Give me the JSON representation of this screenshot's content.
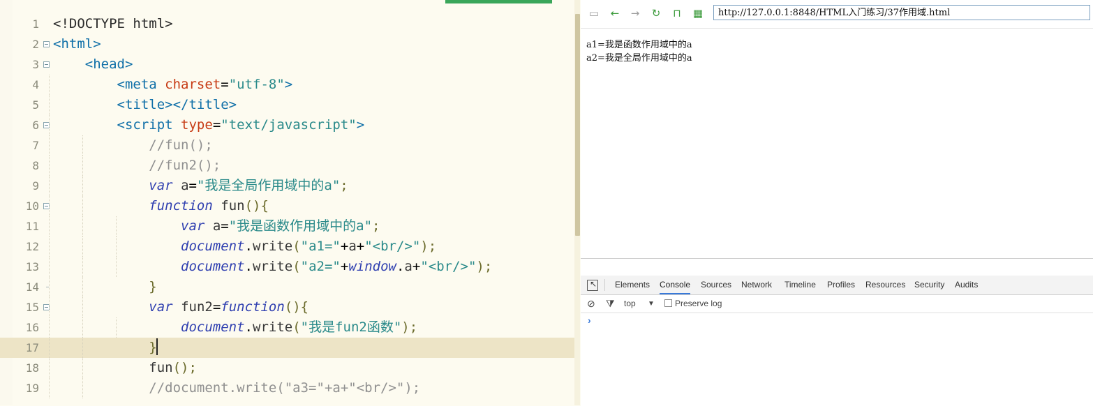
{
  "editor": {
    "lines": [
      {
        "num": "1",
        "html": "<span class=\"t-plain\">&lt;!DOCTYPE html&gt;</span>"
      },
      {
        "num": "2",
        "html": "<span class=\"t-tag\">&lt;html&gt;</span>"
      },
      {
        "num": "3",
        "html": "    <span class=\"t-tag\">&lt;head&gt;</span>"
      },
      {
        "num": "4",
        "html": "        <span class=\"t-tag\">&lt;meta</span> <span class=\"t-attr\">charset</span>=<span class=\"t-str\">\"utf-8\"</span><span class=\"t-tag\">&gt;</span>"
      },
      {
        "num": "5",
        "html": "        <span class=\"t-tag\">&lt;title&gt;&lt;/title&gt;</span>"
      },
      {
        "num": "6",
        "html": "        <span class=\"t-tag\">&lt;script</span> <span class=\"t-attr\">type</span>=<span class=\"t-str\">\"text/javascript\"</span><span class=\"t-tag\">&gt;</span>"
      },
      {
        "num": "7",
        "html": "            <span class=\"t-com\">//fun();</span>"
      },
      {
        "num": "8",
        "html": "            <span class=\"t-com\">//fun2();</span>"
      },
      {
        "num": "9",
        "html": "            <span class=\"t-kw\">var</span> <span class=\"t-fn\">a</span>=<span class=\"t-str\">\"我是全局作用域中的a\"</span><span class=\"t-punc\">;</span>"
      },
      {
        "num": "10",
        "html": "            <span class=\"t-kw\">function</span> <span class=\"t-fn\">fun</span><span class=\"t-punc\">(){</span>"
      },
      {
        "num": "11",
        "html": "                <span class=\"t-kw\">var</span> <span class=\"t-fn\">a</span>=<span class=\"t-str\">\"我是函数作用域中的a\"</span><span class=\"t-punc\">;</span>"
      },
      {
        "num": "12",
        "html": "                <span class=\"t-obj\">document</span>.<span class=\"t-fn\">write</span><span class=\"t-punc\">(</span><span class=\"t-str\">\"a1=\"</span>+<span class=\"t-fn\">a</span>+<span class=\"t-str\">\"&lt;br/&gt;\"</span><span class=\"t-punc\">);</span>"
      },
      {
        "num": "13",
        "html": "                <span class=\"t-obj\">document</span>.<span class=\"t-fn\">write</span><span class=\"t-punc\">(</span><span class=\"t-str\">\"a2=\"</span>+<span class=\"t-obj\">window</span>.<span class=\"t-fn\">a</span>+<span class=\"t-str\">\"&lt;br/&gt;\"</span><span class=\"t-punc\">);</span>"
      },
      {
        "num": "14",
        "html": "            <span class=\"t-punc\">}</span>"
      },
      {
        "num": "15",
        "html": "            <span class=\"t-kw\">var</span> <span class=\"t-fn\">fun2</span>=<span class=\"t-kw\">function</span><span class=\"t-punc\">(){</span>"
      },
      {
        "num": "16",
        "html": "                <span class=\"t-obj\">document</span>.<span class=\"t-fn\">write</span><span class=\"t-punc\">(</span><span class=\"t-str\">\"我是fun2函数\"</span><span class=\"t-punc\">);</span>"
      },
      {
        "num": "17",
        "html": "            <span class=\"t-punc\">}</span><span class=\"cursor\"></span>"
      },
      {
        "num": "18",
        "html": "            <span class=\"t-fn\">fun</span><span class=\"t-punc\">();</span>"
      },
      {
        "num": "19",
        "html": "            <span class=\"t-com\">//document.write(\"a3=\"+a+\"&lt;br/&gt;\");</span>"
      }
    ],
    "fold_open_lines": [
      "2",
      "3",
      "6",
      "10",
      "15"
    ],
    "fold_end_lines": [
      "14"
    ],
    "active_line": "17"
  },
  "browser": {
    "url": "http://127.0.0.1:8848/HTML入门练习/37作用域.html",
    "nav_icons": [
      "console-icon",
      "back-icon",
      "forward-icon",
      "reload-icon",
      "lock-icon",
      "qr-icon"
    ],
    "page_lines": [
      "a1=我是函数作用域中的a",
      "a2=我是全局作用域中的a"
    ]
  },
  "devtools": {
    "tabs": [
      "Elements",
      "Console",
      "Sources",
      "Network",
      "Timeline",
      "Profiles",
      "Resources",
      "Security",
      "Audits"
    ],
    "active_tab": "Console",
    "context": "top",
    "preserve_log_label": "Preserve log",
    "prompt": "›"
  }
}
